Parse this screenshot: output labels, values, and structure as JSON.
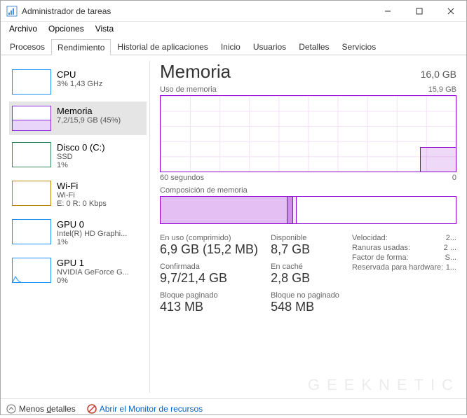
{
  "window": {
    "title": "Administrador de tareas"
  },
  "menu": [
    "Archivo",
    "Opciones",
    "Vista"
  ],
  "tabs": [
    "Procesos",
    "Rendimiento",
    "Historial de aplicaciones",
    "Inicio",
    "Usuarios",
    "Detalles",
    "Servicios"
  ],
  "active_tab": 1,
  "sidebar": [
    {
      "title": "CPU",
      "sub": "3% 1,43 GHz",
      "color": "#1e90ff"
    },
    {
      "title": "Memoria",
      "sub": "7,2/15,9 GB (45%)",
      "color": "#8a2be2",
      "selected": true
    },
    {
      "title": "Disco 0 (C:)",
      "sub1": "SSD",
      "sub2": "1%",
      "color": "#2e8b57"
    },
    {
      "title": "Wi-Fi",
      "sub1": "Wi-Fi",
      "sub2": "E: 0 R: 0 Kbps",
      "color": "#b8860b"
    },
    {
      "title": "GPU 0",
      "sub1": "Intel(R) HD Graphi...",
      "sub2": "1%",
      "color": "#1e90ff"
    },
    {
      "title": "GPU 1",
      "sub1": "NVIDIA GeForce G...",
      "sub2": "0%",
      "color": "#1e90ff"
    }
  ],
  "main": {
    "title": "Memoria",
    "total": "16,0 GB",
    "usage_label": "Uso de memoria",
    "usage_max": "15,9 GB",
    "axis_left": "60 segundos",
    "axis_right": "0",
    "composition_label": "Composición de memoria"
  },
  "stats": {
    "in_use": {
      "label": "En uso (comprimido)",
      "value": "6,9 GB (15,2 MB)"
    },
    "available": {
      "label": "Disponible",
      "value": "8,7 GB"
    },
    "committed": {
      "label": "Confirmada",
      "value": "9,7/21,4 GB"
    },
    "cached": {
      "label": "En caché",
      "value": "2,8 GB"
    },
    "paged": {
      "label": "Bloque paginado",
      "value": "413 MB"
    },
    "nonpaged": {
      "label": "Bloque no paginado",
      "value": "548 MB"
    }
  },
  "specs": {
    "speed": {
      "label": "Velocidad:",
      "value": "2..."
    },
    "slots": {
      "label": "Ranuras usadas:",
      "value": "2 ..."
    },
    "form": {
      "label": "Factor de forma:",
      "value": "S..."
    },
    "reserved": {
      "label": "Reservada para hardware:",
      "value": "1..."
    }
  },
  "footer": {
    "less_details_pre": "Menos ",
    "less_details_u": "d",
    "less_details_post": "etalles",
    "open_monitor": "Abrir el Monitor de recursos"
  },
  "chart_data": {
    "type": "area",
    "title": "Uso de memoria",
    "xlabel": "60 segundos → 0",
    "ylabel": "GB",
    "ylim": [
      0,
      15.9
    ],
    "x_seconds": [
      60,
      55,
      50,
      45,
      40,
      35,
      30,
      25,
      20,
      15,
      10,
      8,
      5,
      0
    ],
    "values": [
      0,
      0,
      0,
      0,
      0,
      0,
      0,
      0,
      0,
      0,
      0,
      5.0,
      5.1,
      5.1
    ],
    "composition_segments": [
      {
        "name": "in_use",
        "fraction": 0.43,
        "color": "rgba(148,0,211,0.25)"
      },
      {
        "name": "modified",
        "fraction": 0.02,
        "color": "rgba(148,0,211,0.45)"
      },
      {
        "name": "standby",
        "fraction": 0.01,
        "color": "rgba(148,0,211,0.10)"
      },
      {
        "name": "free",
        "fraction": 0.54,
        "color": "#ffffff"
      }
    ]
  },
  "watermark": "GEEKNETIC"
}
